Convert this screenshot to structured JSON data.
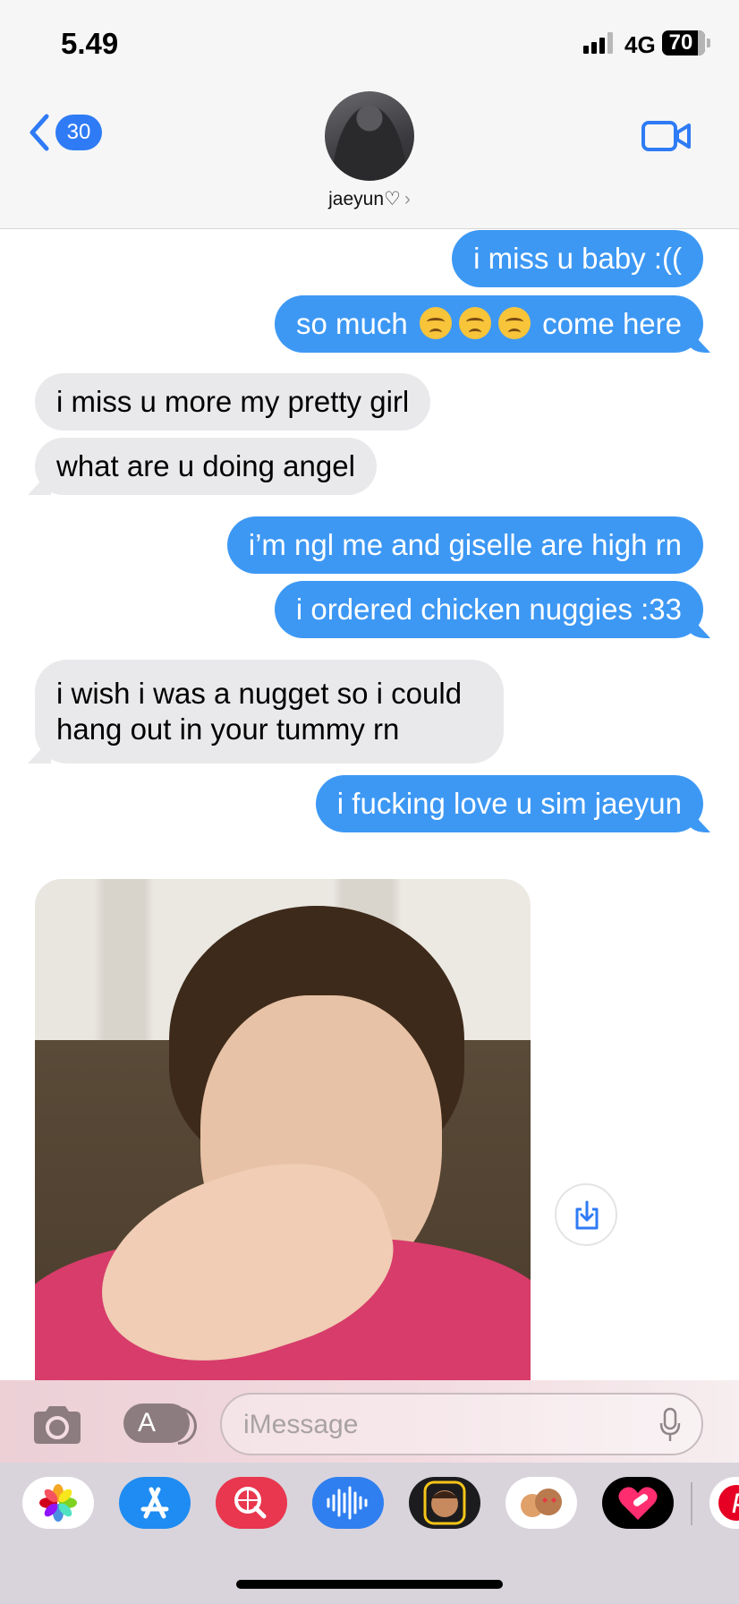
{
  "status_bar": {
    "time": "5.49",
    "network": "4G",
    "battery": "70"
  },
  "header": {
    "back_count": "30",
    "contact_name": "jaeyun♡",
    "contact_chevron": "›"
  },
  "messages": [
    {
      "from": "me",
      "text": "i miss u baby :(("
    },
    {
      "from": "me",
      "text_before": "so much",
      "emoji": [
        "disappointed-face",
        "disappointed-face",
        "disappointed-face"
      ],
      "text_after": "come here"
    },
    {
      "from": "them",
      "text": "i miss u more my pretty girl"
    },
    {
      "from": "them",
      "text": "what are u doing angel"
    },
    {
      "from": "me",
      "text": "i’m ngl me and giselle are high rn"
    },
    {
      "from": "me",
      "text": "i ordered chicken nuggies :33"
    },
    {
      "from": "them",
      "text": "i wish i was a nugget so i could hang out in your tummy rn"
    },
    {
      "from": "me",
      "text": "i fucking love u sim jaeyun"
    },
    {
      "from": "them",
      "type": "photo"
    }
  ],
  "input": {
    "placeholder": "iMessage"
  },
  "icons": {
    "back": "chevron-left-icon",
    "video": "video-camera-icon",
    "save": "save-download-icon",
    "camera": "camera-icon",
    "apps": "app-store-icon",
    "mic": "microphone-icon"
  },
  "app_drawer": [
    "Photos",
    "App Store",
    "Images search",
    "Audio",
    "Memoji",
    "Memoji stickers",
    "Digital Touch",
    "Pinterest"
  ],
  "colors": {
    "outgoing_bubble": "#3d98f4",
    "incoming_bubble": "#e9e9eb",
    "accent": "#2e7bf5"
  }
}
